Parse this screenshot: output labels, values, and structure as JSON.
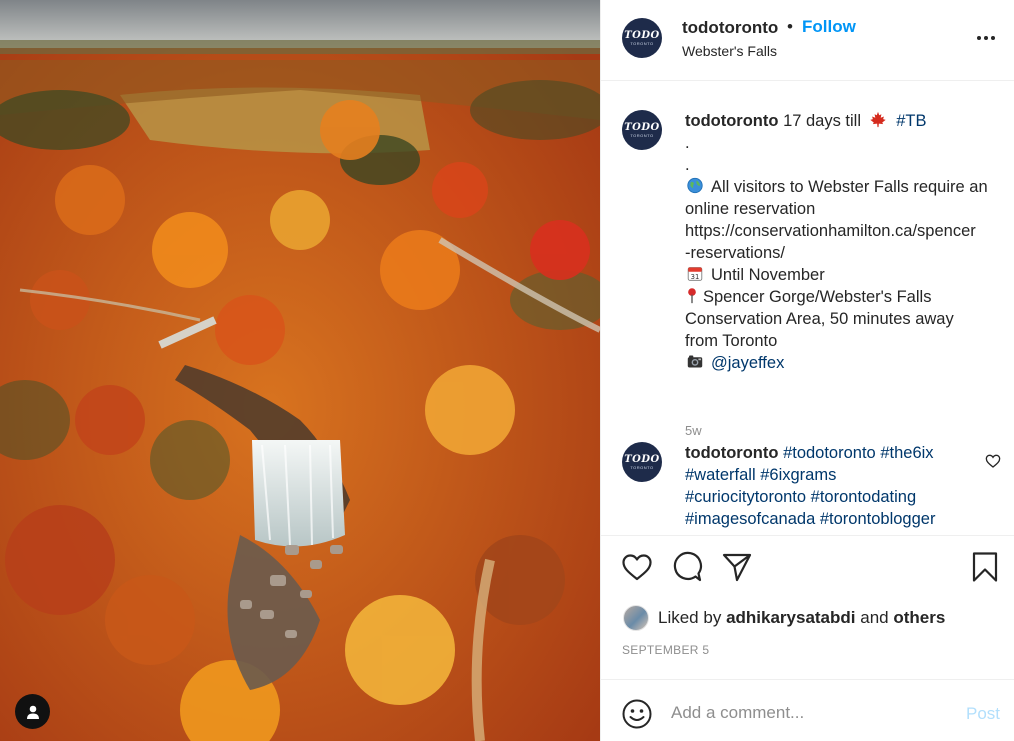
{
  "post": {
    "username": "todotoronto",
    "separator": "•",
    "follow_label": "Follow",
    "location": "Webster's Falls",
    "avatar_top": "TODO",
    "avatar_bottom": "TORONTO"
  },
  "caption": {
    "username": "todotoronto",
    "text_before": "17 days till",
    "hashtag": "#TB",
    "dot1": ".",
    "dot2": ".",
    "line1": "All visitors to Webster Falls require an",
    "line2": "online reservation",
    "line3": "https://conservationhamilton.ca/spencer",
    "line4": "-reservations/",
    "line5": "Until November",
    "line6": "Spencer Gorge/Webster's Falls",
    "line7": "Conservation Area, 50 minutes away",
    "line8": "from Toronto",
    "mention": "@jayeffex",
    "age": "5w",
    "icons": [
      "maple-leaf-icon",
      "globe-icon",
      "calendar-icon",
      "round-pushpin-icon",
      "camera-icon"
    ]
  },
  "comment2": {
    "username": "todotoronto",
    "hashtags": [
      [
        "#todotoronto",
        "#the6ix"
      ],
      [
        "#waterfall",
        "#6ixgrams"
      ],
      [
        "#curiocitytoronto",
        "#torontodating"
      ],
      [
        "#imagesofcanada",
        "#torontoblogger"
      ]
    ]
  },
  "likes": {
    "prefix": "Liked by",
    "user": "adhikarysatabdi",
    "middle": "and",
    "others": "others"
  },
  "date": "SEPTEMBER 5",
  "comment_box": {
    "placeholder": "Add a comment...",
    "post_label": "Post"
  },
  "colors": {
    "follow": "#0095f6",
    "hashtag": "#00376b",
    "muted": "#8e8e8e",
    "post_disabled": "#b2dffc"
  }
}
